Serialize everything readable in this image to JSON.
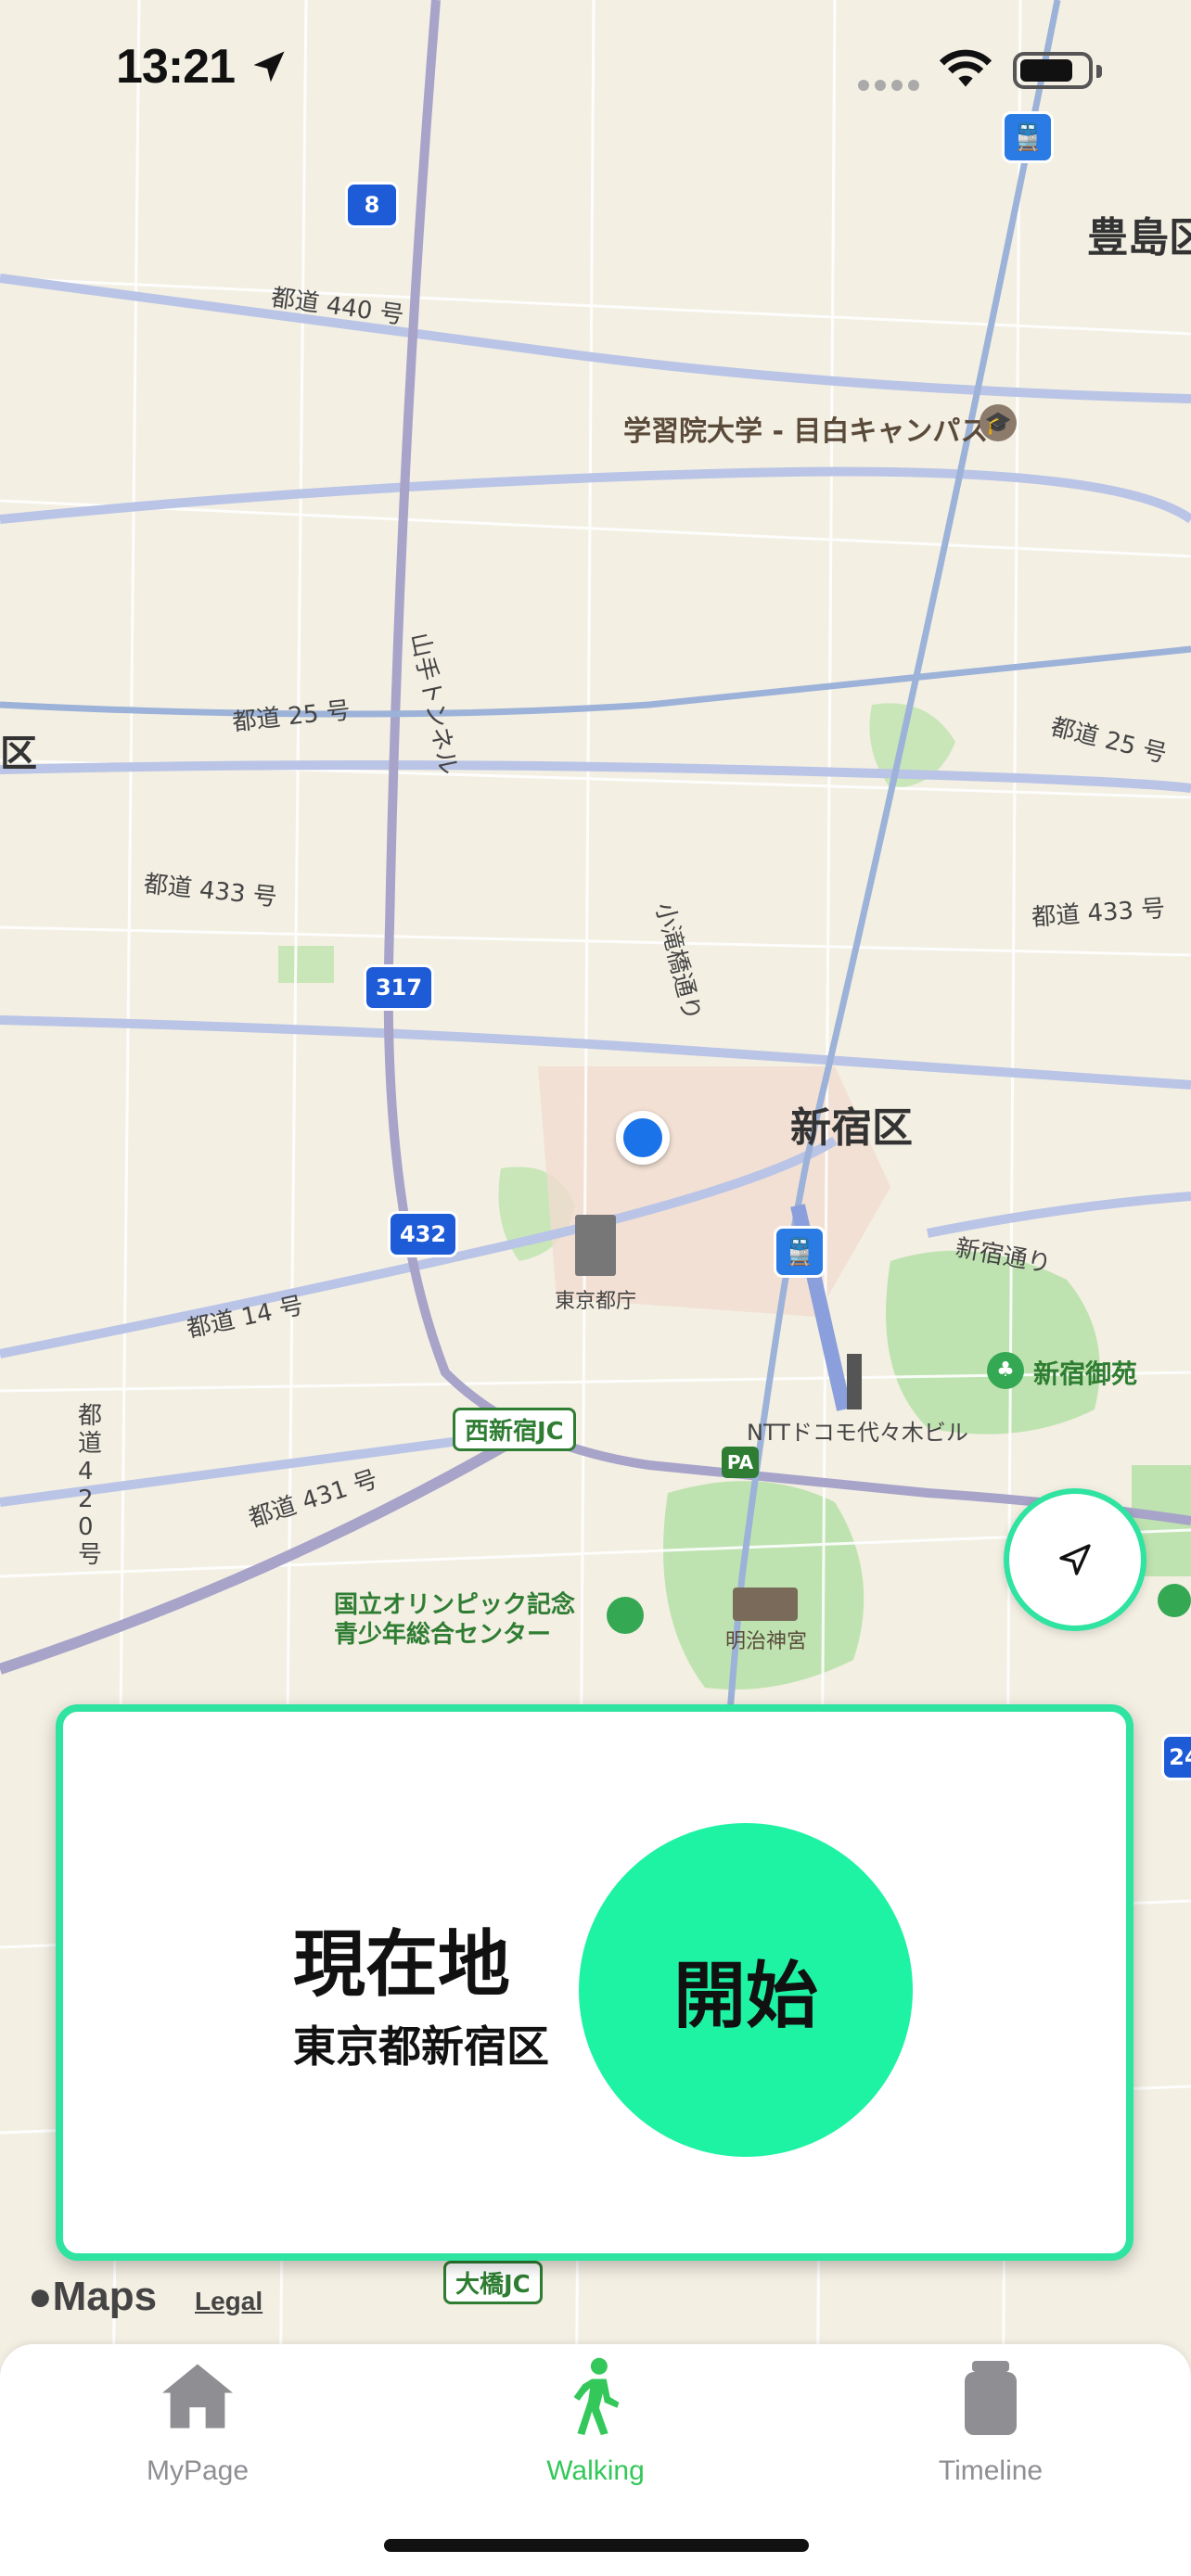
{
  "status": {
    "time": "13:21"
  },
  "map": {
    "labels": {
      "toshima": "豊島区",
      "gakushuin": "学習院大学 - 目白キャンパス",
      "shinjuku_ku": "新宿区",
      "ku_left": "区",
      "tocho": "東京都庁",
      "ntt": "NTTドコモ代々木ビル",
      "gyoen": "新宿御苑",
      "meiji": "明治神宮",
      "olympic_1": "国立オリンピック記念",
      "olympic_2": "青少年総合センター",
      "nishishinjuku_jc": "西新宿JC",
      "ohashi_jc": "大橋JC",
      "pa": "PA",
      "road_440": "都道 440 号",
      "road_25_left": "都道 25 号",
      "road_25_right": "都道 25 号",
      "road_433_left": "都道 433 号",
      "road_433_right": "都道 433 号",
      "road_14": "都道 14 号",
      "road_431": "都道 431 号",
      "road_420": "都道420号",
      "yamate_tunnel": "山手トンネル",
      "otakibashi": "小滝橋通り",
      "shinjuku_dori": "新宿通り"
    },
    "shields": {
      "r8": "8",
      "r317": "317",
      "r432": "432",
      "r24": "24"
    }
  },
  "attribution": {
    "maps": "Maps",
    "legal": "Legal"
  },
  "card": {
    "title": "現在地",
    "subtitle": "東京都新宿区",
    "start_label": "開始"
  },
  "tabs": [
    {
      "label": "MyPage",
      "icon": "house-icon",
      "active": false
    },
    {
      "label": "Walking",
      "icon": "walking-person-icon",
      "active": true
    },
    {
      "label": "Timeline",
      "icon": "cylinder-icon",
      "active": false
    }
  ],
  "colors": {
    "accent": "#2fe3a0",
    "start": "#1ef2a3",
    "tab_active": "#34c759",
    "tab_inactive": "#8e8e93",
    "user_dot": "#1a73e8"
  }
}
